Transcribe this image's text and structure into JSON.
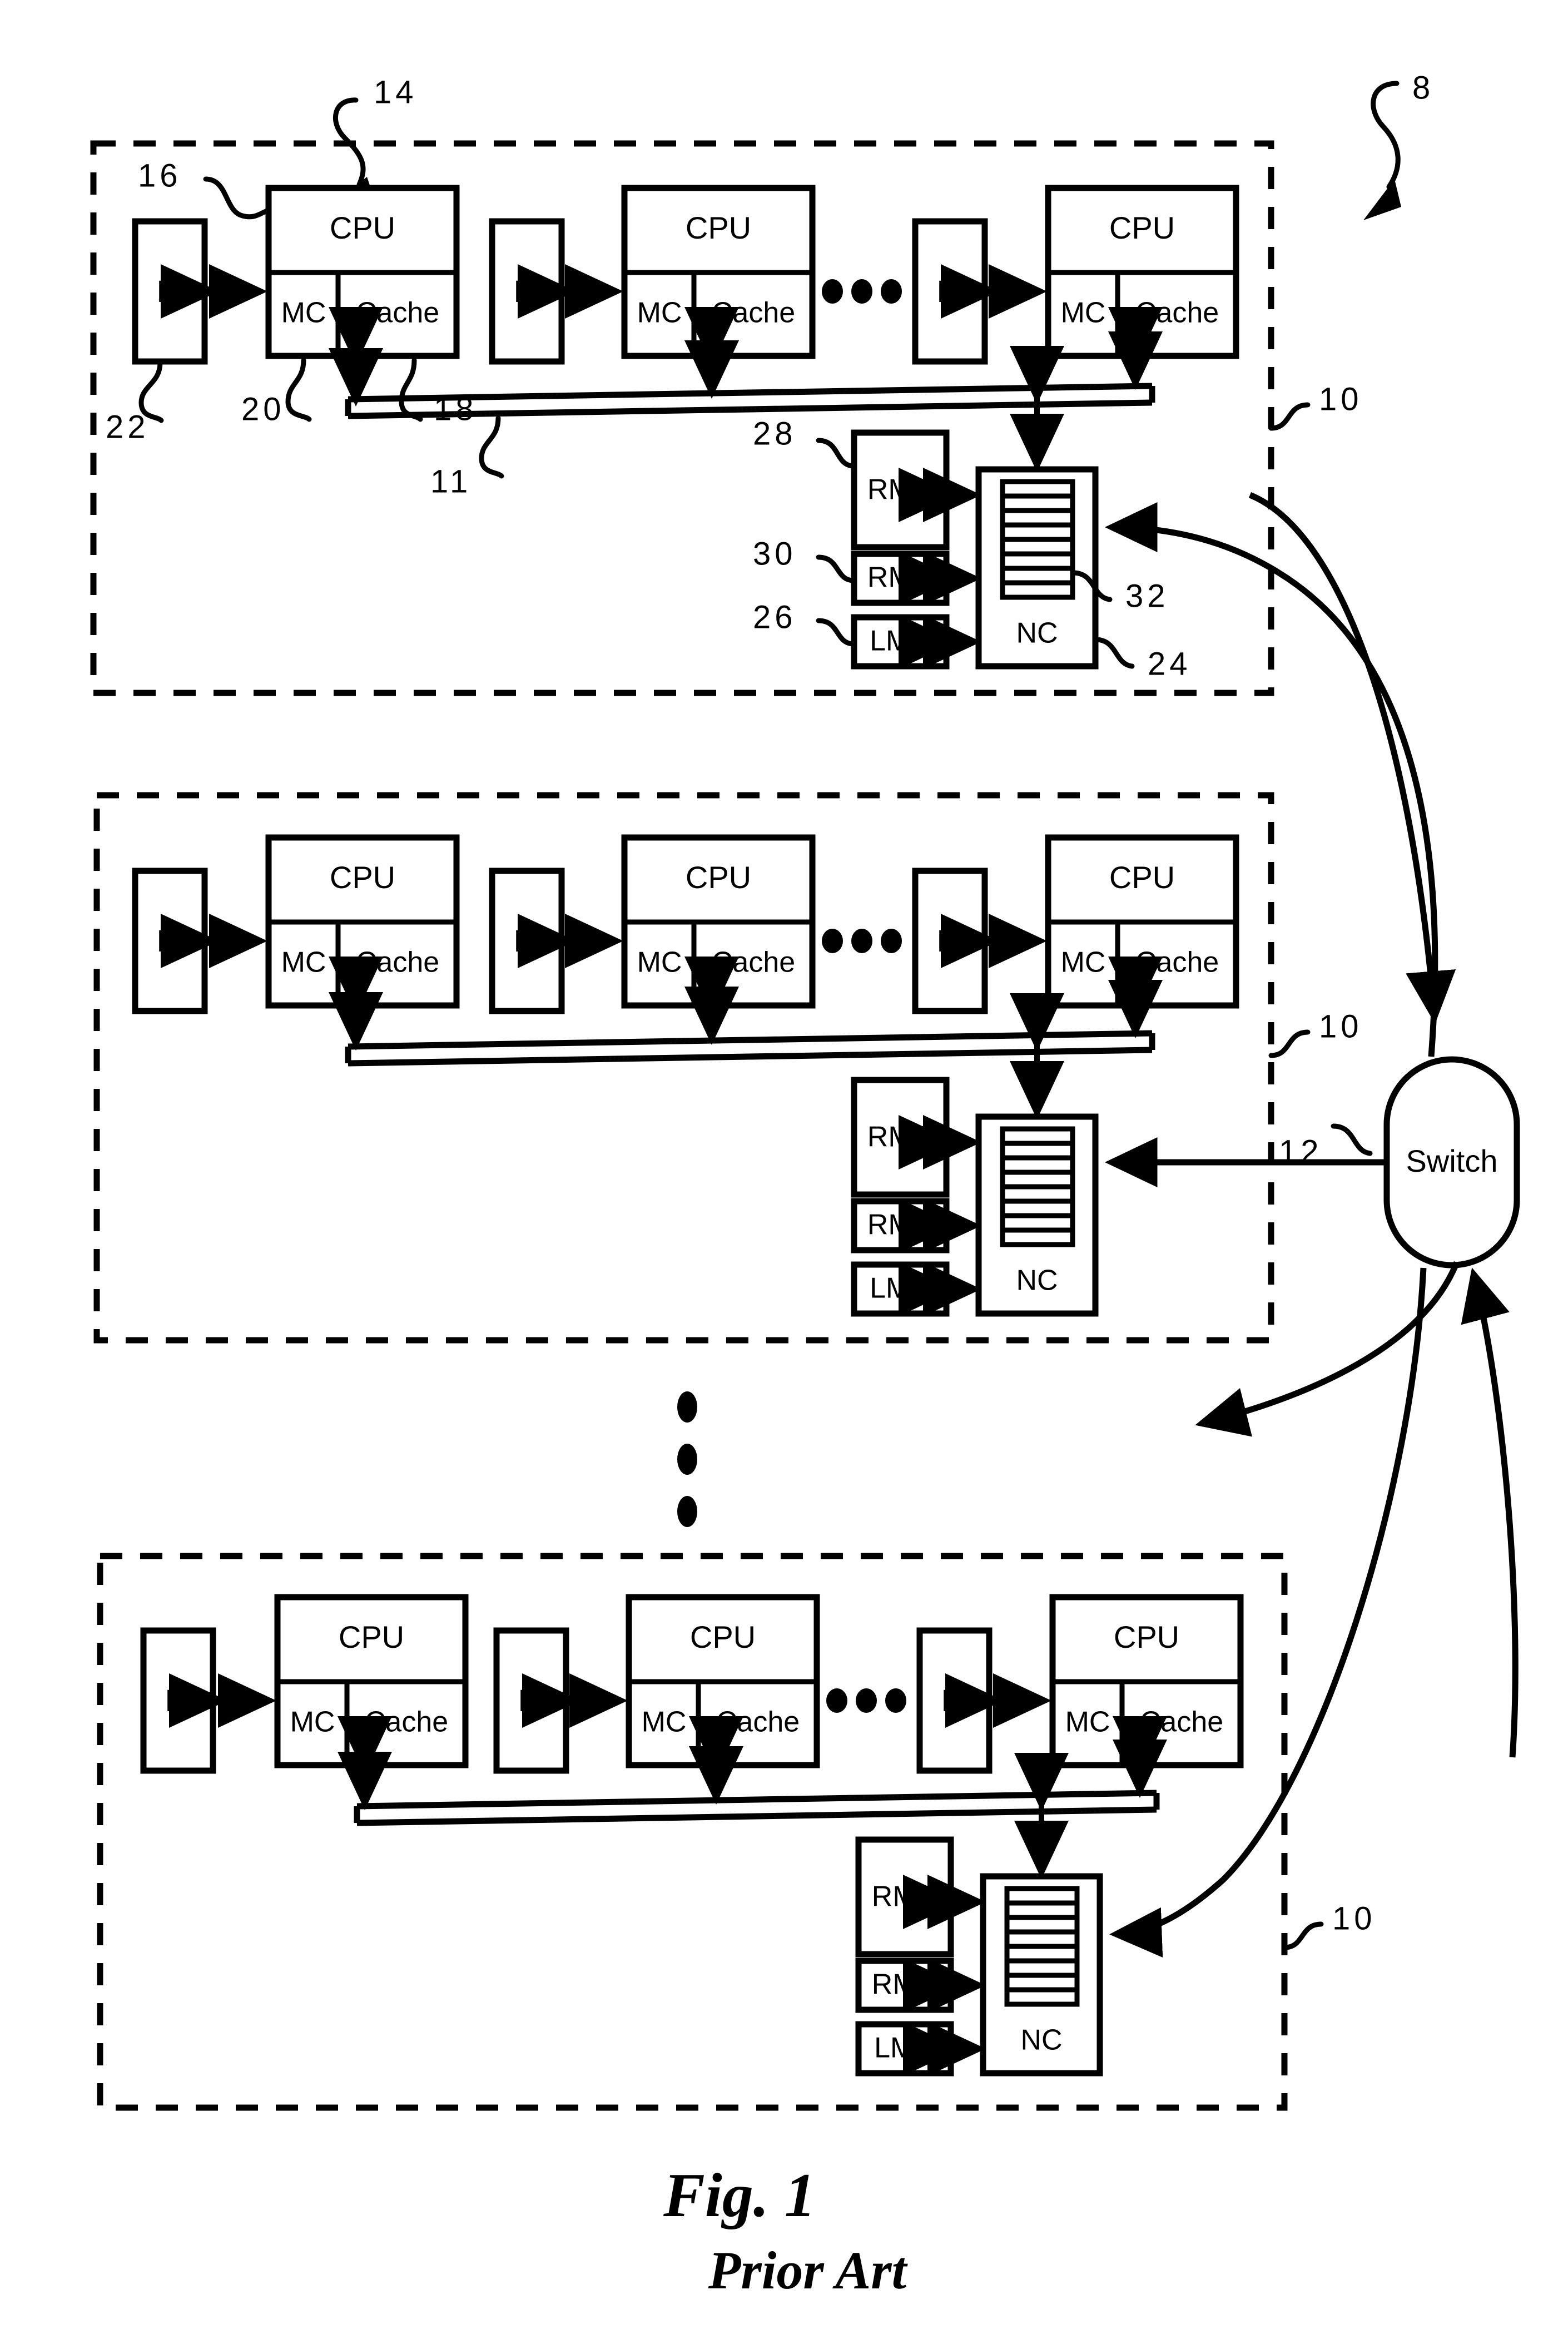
{
  "figure": {
    "caption_line1": "Fig.  1",
    "caption_line2": "Prior Art",
    "system_ref": "8"
  },
  "labels": {
    "cpu": "CPU",
    "mc": "MC",
    "cache": "Cache",
    "memory": "M",
    "rmc": "RMC",
    "rmd": "RMD",
    "lmd": "LMD",
    "nc": "NC",
    "switch": "Switch"
  },
  "reference_numerals": {
    "system": "8",
    "node": "10",
    "bus": "11",
    "switch": "12",
    "cpu_arrow": "14",
    "cpu_module": "16",
    "cache": "18",
    "memory_controller": "20",
    "memory": "22",
    "network_controller": "24",
    "lmd": "26",
    "rmc": "28",
    "rmd": "30",
    "nc_queue": "32"
  },
  "nodes": [
    {
      "id": "node-1",
      "ref": "10",
      "cpus": [
        {
          "cpu": "CPU",
          "mc": "MC",
          "cache": "Cache",
          "memory": "M"
        },
        {
          "cpu": "CPU",
          "mc": "MC",
          "cache": "Cache",
          "memory": "M"
        },
        {
          "cpu": "CPU",
          "mc": "MC",
          "cache": "Cache",
          "memory": "M"
        }
      ],
      "ellipsis": "•••",
      "directories": [
        "RMC",
        "RMD",
        "LMD"
      ],
      "controller": "NC",
      "annotated": true
    },
    {
      "id": "node-2",
      "ref": "10",
      "cpus": [
        {
          "cpu": "CPU",
          "mc": "MC",
          "cache": "Cache",
          "memory": "M"
        },
        {
          "cpu": "CPU",
          "mc": "MC",
          "cache": "Cache",
          "memory": "M"
        },
        {
          "cpu": "CPU",
          "mc": "MC",
          "cache": "Cache",
          "memory": "M"
        }
      ],
      "ellipsis": "•••",
      "directories": [
        "RMC",
        "RMD",
        "LMD"
      ],
      "controller": "NC",
      "annotated": false
    },
    {
      "id": "node-3",
      "ref": "10",
      "cpus": [
        {
          "cpu": "CPU",
          "mc": "MC",
          "cache": "Cache",
          "memory": "M"
        },
        {
          "cpu": "CPU",
          "mc": "MC",
          "cache": "Cache",
          "memory": "M"
        },
        {
          "cpu": "CPU",
          "mc": "MC",
          "cache": "Cache",
          "memory": "M"
        }
      ],
      "ellipsis": "•••",
      "directories": [
        "RMC",
        "RMD",
        "LMD"
      ],
      "controller": "NC",
      "annotated": false
    }
  ],
  "vertical_ellipsis_dots": 3,
  "nc_queue_bars": 8,
  "colors": {
    "ink": "#000000",
    "paper": "#ffffff"
  }
}
